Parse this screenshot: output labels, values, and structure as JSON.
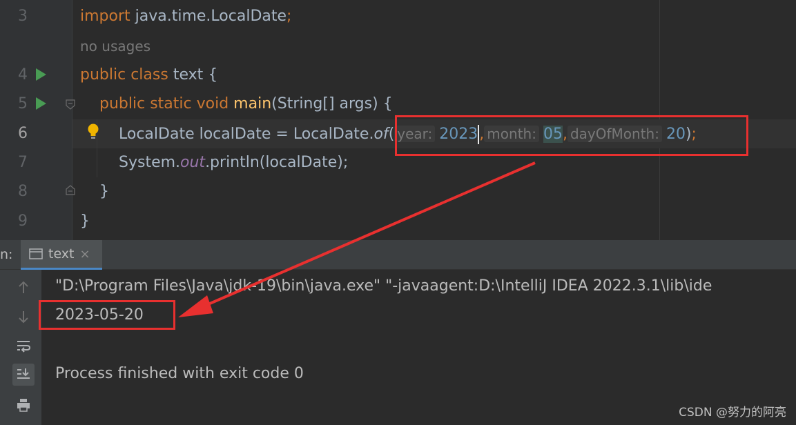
{
  "editor": {
    "line_numbers": [
      "3",
      "4",
      "5",
      "6",
      "7",
      "8",
      "9"
    ],
    "usages_hint": "no usages",
    "line3": {
      "kw_import": "import",
      "rest": " java.time.LocalDate",
      "semi": ";"
    },
    "line4": {
      "kw_public": "public",
      "kw_class": "class",
      "name": " text {"
    },
    "line5": {
      "kw_public": "public",
      "kw_static": "static",
      "kw_void": "void",
      "method": "main",
      "rest": "(String[] args) {"
    },
    "line6": {
      "prefix": "LocalDate localDate = LocalDate.",
      "method": "of",
      "open": "(",
      "hint_year": "year:",
      "val_year": "2023",
      "comma1": ",",
      "hint_month": "month:",
      "val_month": "05",
      "comma2": ",",
      "hint_day": "dayOfMonth:",
      "val_day": "20",
      "close": ")",
      "semi": ";"
    },
    "line7": {
      "prefix": "System.",
      "field": "out",
      "rest": ".println(localDate);"
    },
    "line8": "}",
    "line9": "}"
  },
  "run_panel": {
    "tab_prefix": "n:",
    "tab_label": "text",
    "tab_close": "×",
    "console": {
      "command": "\"D:\\Program Files\\Java\\jdk-19\\bin\\java.exe\" \"-javaagent:D:\\IntelliJ IDEA 2022.3.1\\lib\\ide",
      "output": "2023-05-20",
      "exit": "Process finished with exit code 0"
    }
  },
  "watermark": "CSDN @努力的阿亮",
  "colors": {
    "annotation_red": "#e8302f",
    "keyword": "#cc7832",
    "number": "#6897bb",
    "method": "#ffc66d"
  }
}
